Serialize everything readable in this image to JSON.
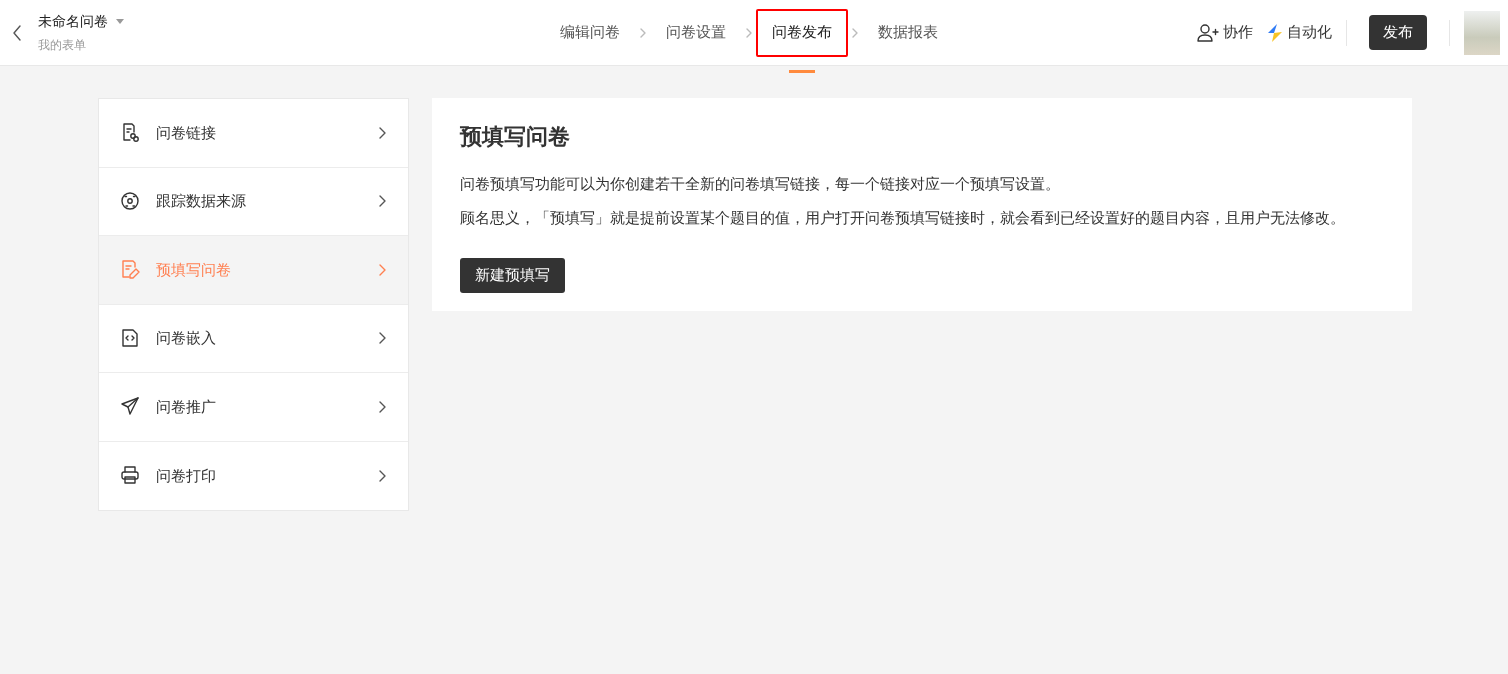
{
  "header": {
    "title": "未命名问卷",
    "subtitle": "我的表单"
  },
  "steps": [
    {
      "label": "编辑问卷",
      "selected": false,
      "highlighted": false
    },
    {
      "label": "问卷设置",
      "selected": false,
      "highlighted": false
    },
    {
      "label": "问卷发布",
      "selected": true,
      "highlighted": true
    },
    {
      "label": "数据报表",
      "selected": false,
      "highlighted": false
    }
  ],
  "actions": {
    "collaborate": "协作",
    "automation": "自动化",
    "publish": "发布"
  },
  "sidebar": {
    "items": [
      {
        "label": "问卷链接",
        "kind": "link-doc",
        "selected": false
      },
      {
        "label": "跟踪数据来源",
        "kind": "target",
        "selected": false
      },
      {
        "label": "预填写问卷",
        "kind": "edit-doc",
        "selected": true
      },
      {
        "label": "问卷嵌入",
        "kind": "code-doc",
        "selected": false
      },
      {
        "label": "问卷推广",
        "kind": "send",
        "selected": false
      },
      {
        "label": "问卷打印",
        "kind": "printer",
        "selected": false
      }
    ]
  },
  "panel": {
    "title": "预填写问卷",
    "paragraphs": [
      "问卷预填写功能可以为你创建若干全新的问卷填写链接，每一个链接对应一个预填写设置。",
      "顾名思义，「预填写」就是提前设置某个题目的值，用户打开问卷预填写链接时，就会看到已经设置好的题目内容，且用户无法修改。"
    ],
    "button": "新建预填写"
  }
}
